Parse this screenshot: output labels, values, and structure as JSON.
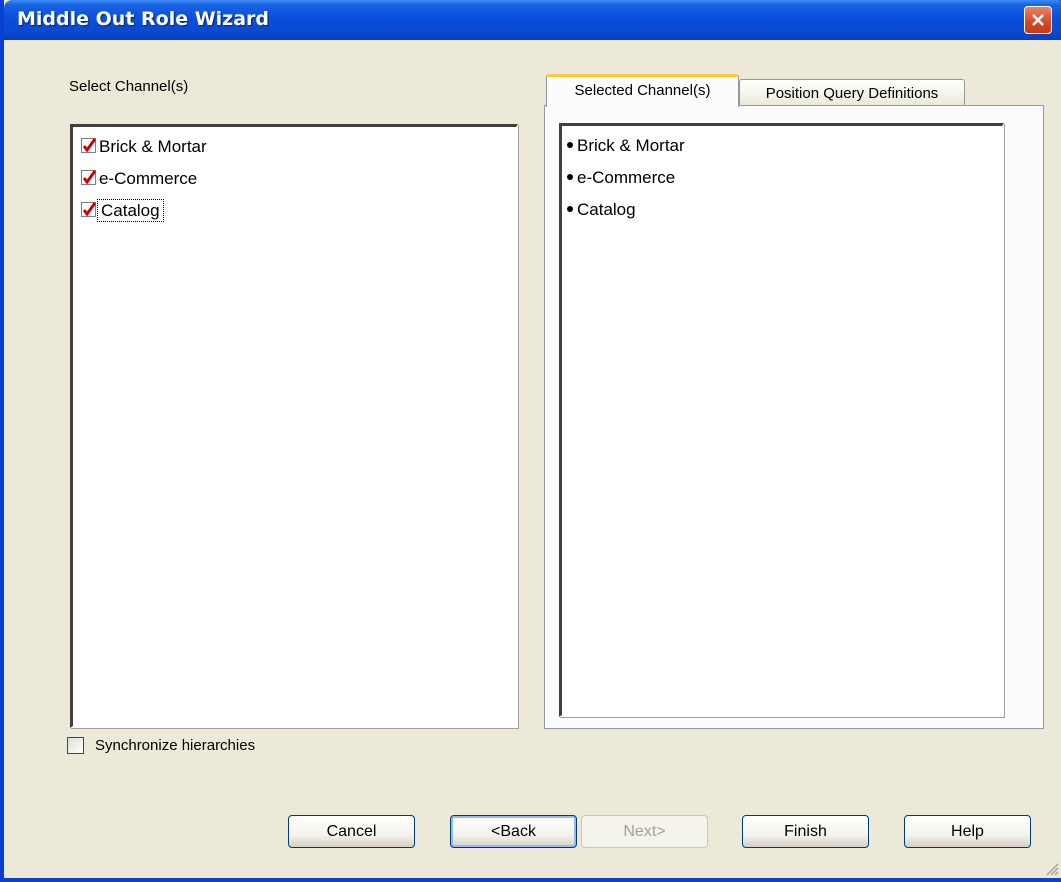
{
  "window": {
    "title": "Middle Out Role Wizard"
  },
  "left": {
    "label": "Select Channel(s)",
    "items": [
      {
        "label": "Brick & Mortar",
        "checked": true
      },
      {
        "label": "e-Commerce",
        "checked": true
      },
      {
        "label": "Catalog",
        "checked": true
      }
    ]
  },
  "tabs": [
    {
      "label": "Selected Channel(s)",
      "active": true
    },
    {
      "label": "Position Query Definitions",
      "active": false
    }
  ],
  "selected": {
    "items": [
      "Brick & Mortar",
      "e-Commerce",
      "Catalog"
    ]
  },
  "sync": {
    "label": "Synchronize hierarchies",
    "checked": false
  },
  "buttons": {
    "cancel": "Cancel",
    "back": "<Back",
    "next": "Next>",
    "finish": "Finish",
    "help": "Help"
  },
  "colors": {
    "title_bar": "#0a4fdb",
    "check_mark": "#d10000",
    "tab_highlight": "#ffc83c",
    "dialog_bg": "#ece9d8"
  },
  "icons": {
    "close": "close-icon",
    "check": "check-icon",
    "grip": "resize-grip-icon"
  }
}
